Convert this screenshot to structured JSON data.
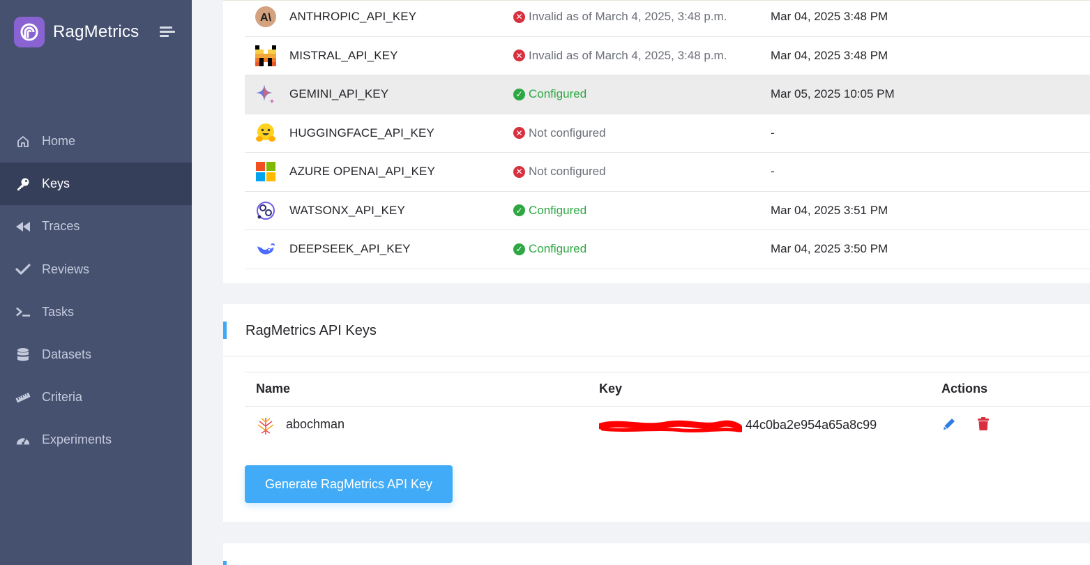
{
  "brand": {
    "name": "RagMetrics"
  },
  "nav": [
    {
      "label": "Home",
      "icon": "home-icon"
    },
    {
      "label": "Keys",
      "icon": "key-icon",
      "active": true
    },
    {
      "label": "Traces",
      "icon": "rewind-icon"
    },
    {
      "label": "Reviews",
      "icon": "check-icon"
    },
    {
      "label": "Tasks",
      "icon": "terminal-icon"
    },
    {
      "label": "Datasets",
      "icon": "database-icon"
    },
    {
      "label": "Criteria",
      "icon": "ruler-icon"
    },
    {
      "label": "Experiments",
      "icon": "gauge-icon"
    }
  ],
  "providers": [
    {
      "name": "ANTHROPIC_API_KEY",
      "icon": "anthropic-icon",
      "status": "Invalid as of March 4, 2025, 3:48 p.m.",
      "state": "invalid",
      "date": "Mar 04, 2025 3:48 PM"
    },
    {
      "name": "MISTRAL_API_KEY",
      "icon": "mistral-icon",
      "status": "Invalid as of March 4, 2025, 3:48 p.m.",
      "state": "invalid",
      "date": "Mar 04, 2025 3:48 PM"
    },
    {
      "name": "GEMINI_API_KEY",
      "icon": "gemini-icon",
      "status": "Configured",
      "state": "ok",
      "date": "Mar 05, 2025 10:05 PM",
      "highlighted": true
    },
    {
      "name": "HUGGINGFACE_API_KEY",
      "icon": "huggingface-icon",
      "status": "Not configured",
      "state": "invalid",
      "date": "-"
    },
    {
      "name": "AZURE OPENAI_API_KEY",
      "icon": "microsoft-icon",
      "status": "Not configured",
      "state": "invalid",
      "date": "-"
    },
    {
      "name": "WATSONX_API_KEY",
      "icon": "watsonx-icon",
      "status": "Configured",
      "state": "ok",
      "date": "Mar 04, 2025 3:51 PM"
    },
    {
      "name": "DEEPSEEK_API_KEY",
      "icon": "deepseek-icon",
      "status": "Configured",
      "state": "ok",
      "date": "Mar 04, 2025 3:50 PM"
    }
  ],
  "ragmetrics": {
    "title": "RagMetrics API Keys",
    "columns": {
      "name": "Name",
      "key": "Key",
      "actions": "Actions"
    },
    "row": {
      "name": "abochman",
      "key_visible_suffix": "44c0ba2e954a65a8c99"
    },
    "generate_label": "Generate RagMetrics API Key"
  },
  "colors": {
    "sidebar": "#465170",
    "sidebar_active": "#363f59",
    "accent": "#41abf7",
    "ok": "#2ea743",
    "bad": "#d9303f"
  }
}
